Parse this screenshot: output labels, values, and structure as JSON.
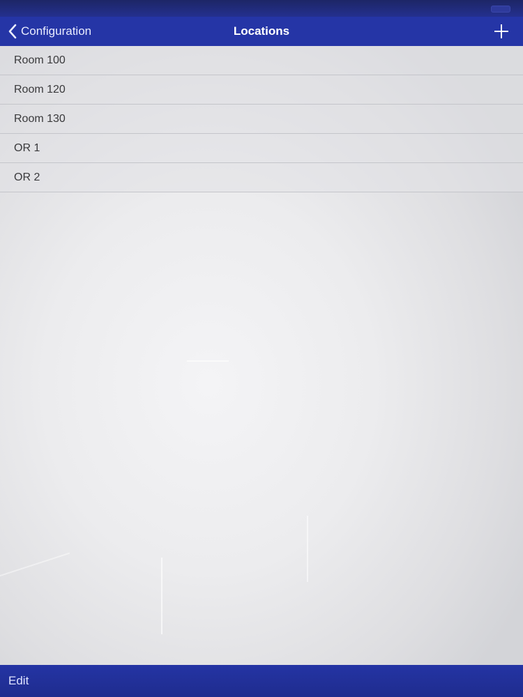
{
  "nav": {
    "back_label": "Configuration",
    "title": "Locations",
    "back_icon": "chevron-left-icon",
    "add_icon": "plus-icon"
  },
  "locations": [
    {
      "label": "Room 100"
    },
    {
      "label": "Room 120"
    },
    {
      "label": "Room 130"
    },
    {
      "label": "OR 1"
    },
    {
      "label": "OR 2"
    }
  ],
  "toolbar": {
    "edit_label": "Edit"
  },
  "colors": {
    "nav_background": "#2535a6",
    "toolbar_background": "#2232a0",
    "list_text": "#3a3a3c",
    "nav_text": "#ffffff"
  }
}
